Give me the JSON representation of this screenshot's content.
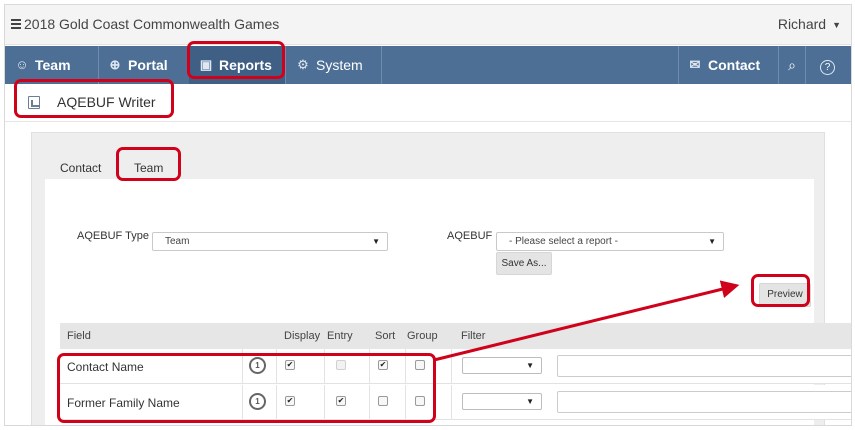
{
  "app": {
    "title": "2018 Gold Coast Commonwealth Games",
    "user": "Richard"
  },
  "nav": {
    "team": "Team",
    "portal": "Portal",
    "reports": "Reports",
    "system": "System",
    "contact": "Contact",
    "icons": [
      "team-icon",
      "globe-icon",
      "report-icon",
      "gear-icon",
      "envelope-icon",
      "search-icon",
      "help-icon"
    ]
  },
  "page": {
    "title": "AQEBUF Writer"
  },
  "tabs": [
    "Contact",
    "Team"
  ],
  "form": {
    "type_label": "AQEBUF Type",
    "type_value": "Team",
    "report_label": "AQEBUF",
    "report_placeholder": "- Please select a report -",
    "save_as": "Save As...",
    "preview": "Preview"
  },
  "grid": {
    "columns": [
      "Field",
      "Display",
      "Entry",
      "Sort",
      "Group",
      "Filter"
    ],
    "rows": [
      {
        "field": "Contact Name",
        "display": true,
        "entry": false,
        "entry_disabled": true,
        "sort": true,
        "group": false
      },
      {
        "field": "Former Family Name",
        "display": true,
        "entry": true,
        "entry_disabled": false,
        "sort": false,
        "group": false
      }
    ]
  },
  "colors": {
    "nav": "#4d6f95",
    "highlight": "#d0021b"
  }
}
